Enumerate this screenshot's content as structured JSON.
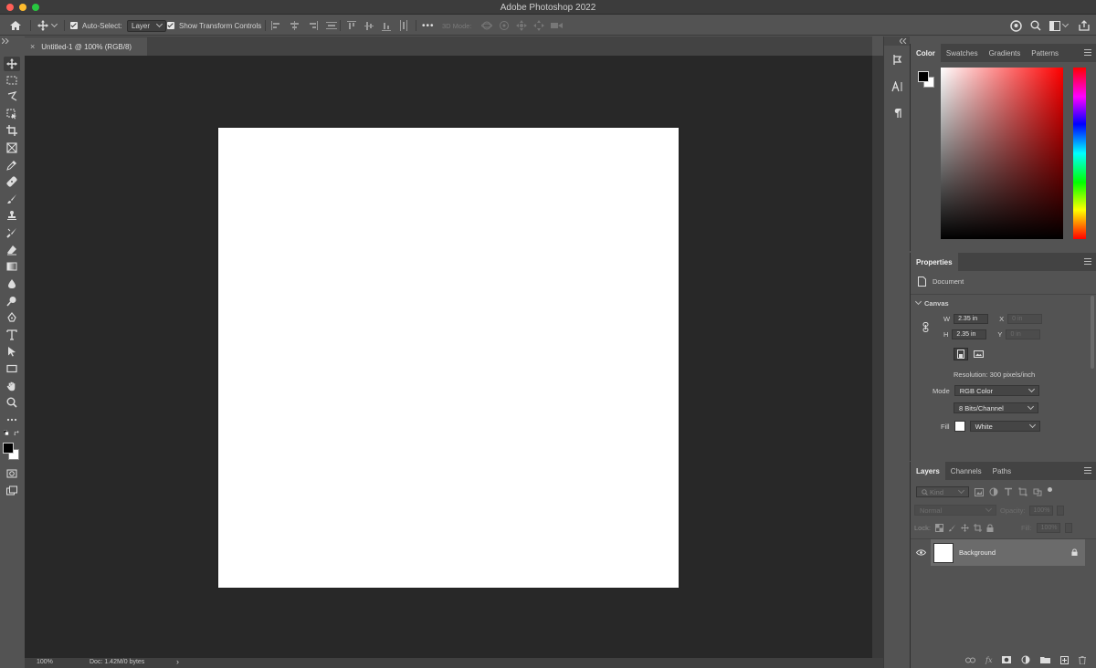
{
  "app": {
    "title": "Adobe Photoshop 2022"
  },
  "options_bar": {
    "auto_select_label": "Auto-Select:",
    "auto_select_value": "Layer",
    "show_transform_label": "Show Transform Controls",
    "mode_3d_label": "3D Mode:",
    "more": "•••"
  },
  "document": {
    "tab_label": "Untitled-1 @ 100% (RGB/8)",
    "close_glyph": "×"
  },
  "status": {
    "zoom": "100%",
    "doc_info": "Doc: 1.42M/0 bytes",
    "arrow": "›"
  },
  "color_panel": {
    "tabs": [
      "Color",
      "Swatches",
      "Gradients",
      "Patterns"
    ],
    "active_tab": "Color",
    "colors": {
      "foreground": "#000000",
      "background": "#ffffff",
      "hue": "#ff0000"
    }
  },
  "properties_panel": {
    "title": "Properties",
    "type_label": "Document",
    "section": "Canvas",
    "w_label": "W",
    "w_value": "2.35 in",
    "h_label": "H",
    "h_value": "2.35 in",
    "x_label": "X",
    "x_placeholder": "0 in",
    "y_label": "Y",
    "y_placeholder": "0 in",
    "resolution": "Resolution: 300 pixels/inch",
    "mode_label": "Mode",
    "mode_value": "RGB Color",
    "bits_value": "8 Bits/Channel",
    "fill_label": "Fill",
    "fill_value": "White"
  },
  "layers_panel": {
    "tabs": [
      "Layers",
      "Channels",
      "Paths"
    ],
    "active_tab": "Layers",
    "kind_placeholder": "Kind",
    "blend_mode": "Normal",
    "opacity_label": "Opacity:",
    "opacity_value": "100%",
    "lock_label": "Lock:",
    "fill_label": "Fill:",
    "fill_value": "100%",
    "layers": [
      {
        "name": "Background",
        "visible": true,
        "locked": true
      }
    ]
  }
}
